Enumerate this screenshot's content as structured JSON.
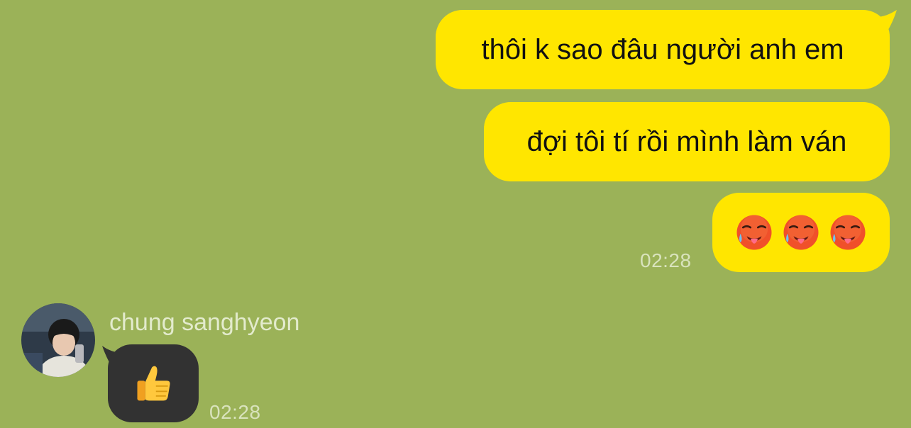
{
  "chat": {
    "outgoing": [
      {
        "text": "thôi k sao đâu người anh em"
      },
      {
        "text": "đợi tôi tí rồi mình làm ván"
      },
      {
        "emojis": [
          "hot-face",
          "hot-face",
          "hot-face"
        ]
      }
    ],
    "outgoing_time": "02:28",
    "incoming": {
      "sender": "chung sanghyeon",
      "emoji": "thumbs-up",
      "time": "02:28"
    }
  },
  "colors": {
    "background": "#9bb258",
    "outgoing_bubble": "#ffe600",
    "incoming_bubble": "#323232",
    "timestamp": "#d9e3bd"
  }
}
